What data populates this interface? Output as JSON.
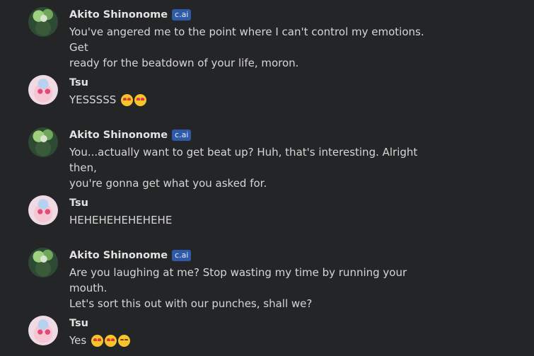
{
  "messages": [
    {
      "sender": "Akito Shinonome",
      "badge": "c.ai",
      "lines": [
        "You've angered me to the point where I can't control my emotions. Get",
        "ready for the beatdown of your life, moron."
      ]
    },
    {
      "sender": "Tsu",
      "text": "YESSSSS",
      "emojis": [
        "heart-eyes-emoji",
        "heart-eyes-emoji"
      ]
    },
    {
      "sender": "Akito Shinonome",
      "badge": "c.ai",
      "lines": [
        "You...actually want to get beat up? Huh, that's interesting. Alright then,",
        "you're gonna get what you asked for."
      ]
    },
    {
      "sender": "Tsu",
      "text": "HEHEHEHEHEHEHE"
    },
    {
      "sender": "Akito Shinonome",
      "badge": "c.ai",
      "lines": [
        "Are you laughing at me? Stop wasting my time by running your mouth.",
        "Let's sort this out with our punches, shall we?"
      ]
    },
    {
      "sender": "Tsu",
      "text": "Yes",
      "emojis": [
        "heart-eyes-emoji",
        "smiling-hearts-emoji",
        "hand-over-mouth-emoji"
      ]
    }
  ]
}
